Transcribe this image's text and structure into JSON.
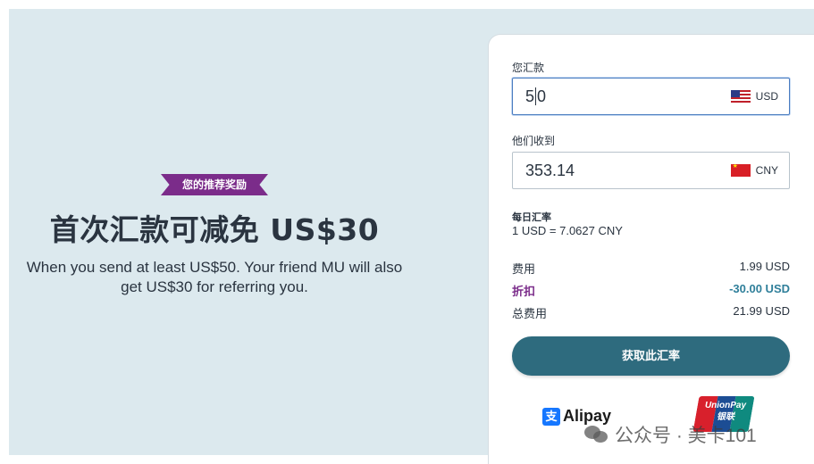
{
  "promo": {
    "badge": "您的推荐奖励",
    "title": "首次汇款可减免 US$30",
    "description": "When you send at least US$50. Your friend MU will also get US$30 for referring you."
  },
  "converter": {
    "send_label": "您汇款",
    "send_amount_before_caret": "5",
    "send_amount_after_caret": "0",
    "send_currency": "USD",
    "receive_label": "他们收到",
    "receive_amount": "353.14",
    "receive_currency": "CNY"
  },
  "rate": {
    "title": "每日汇率",
    "value": "1 USD = 7.0627 CNY"
  },
  "fees": {
    "fee_label": "费用",
    "fee_amount": "1.99 USD",
    "discount_label": "折扣",
    "discount_amount": "-30.00 USD",
    "total_label": "总费用",
    "total_amount": "21.99 USD"
  },
  "cta": {
    "label": "获取此汇率"
  },
  "payments": {
    "alipay_label": "Alipay",
    "alipay_icon_glyph": "支",
    "unionpay_line1": "UnionPay",
    "unionpay_line2": "银联"
  },
  "watermark": {
    "text": "公众号 · 美卡101"
  },
  "colors": {
    "background": "#dce9ee",
    "accent_purple": "#7b2c8a",
    "button": "#2e6b7e",
    "discount_amount": "#2f7f9a"
  }
}
